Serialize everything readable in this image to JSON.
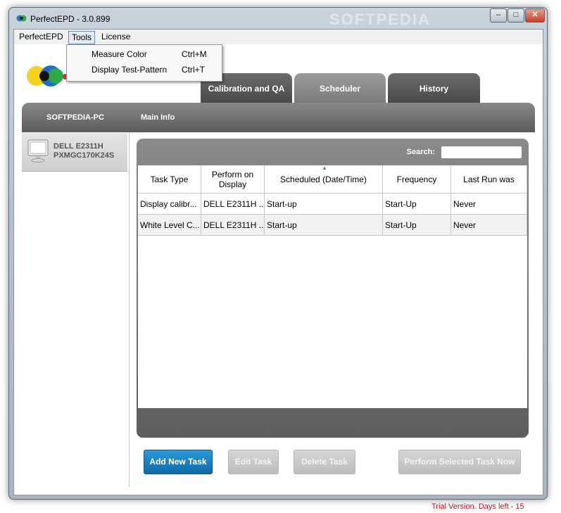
{
  "window": {
    "title": "PerfectEPD - 3.0.899",
    "watermark": "SOFTPEDIA",
    "controls": {
      "minimize": "–",
      "maximize": "□",
      "close": "✕"
    }
  },
  "menubar": {
    "items": [
      "PerfectEPD",
      "Tools",
      "License"
    ],
    "active": "Tools"
  },
  "tools_menu": [
    {
      "label": "Measure Color",
      "shortcut": "Ctrl+M"
    },
    {
      "label": "Display Test-Pattern",
      "shortcut": "Ctrl+T"
    }
  ],
  "tabs": [
    {
      "label": "Calibration and QA",
      "active": false
    },
    {
      "label": "Scheduler",
      "active": true
    },
    {
      "label": "History",
      "active": false
    }
  ],
  "left_panel": {
    "header": "SOFTPEDIA-PC",
    "device": {
      "line1": "DELL E2311H",
      "line2": "PXMGC170K24S",
      "icon": "monitor-icon"
    }
  },
  "main": {
    "header": "Main Info",
    "search": {
      "label": "Search:",
      "value": ""
    },
    "columns": [
      "Task Type",
      "Perform on Display",
      "Scheduled (Date/Time)",
      "Frequency",
      "Last Run was"
    ],
    "rows": [
      [
        "Display calibr...",
        "DELL E2311H ...",
        "Start-up",
        "Start-Up",
        "Never"
      ],
      [
        "White Level C...",
        "DELL E2311H ...",
        "Start-up",
        "Start-Up",
        "Never"
      ]
    ]
  },
  "buttons": {
    "add": "Add New Task",
    "edit": "Edit Task",
    "delete": "Delete Task",
    "perform": "Perform Selected Task Now"
  },
  "status": {
    "trial": "Trial Version. Days left - 15"
  },
  "colors": {
    "accent": "#1b7fc0",
    "trial_text": "#c0141b",
    "panel_dark": "#5c5c5c"
  }
}
